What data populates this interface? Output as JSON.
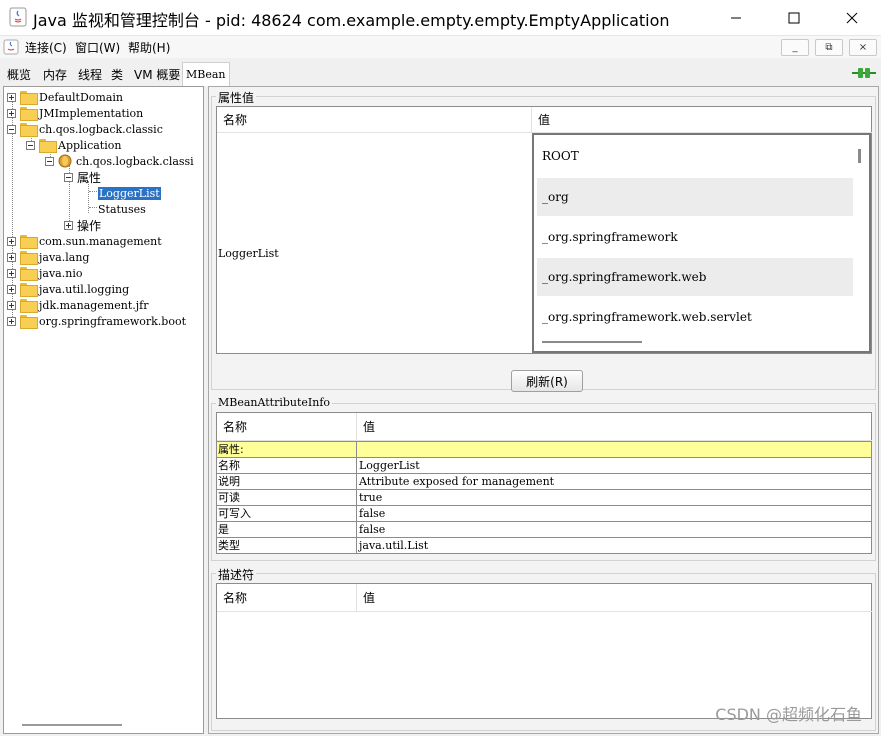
{
  "window": {
    "title": "Java 监视和管理控制台 - pid: 48624 com.example.empty.empty.EmptyApplication",
    "controls": {
      "minimize": "—",
      "maximize": "☐",
      "close": "✕"
    }
  },
  "menu": {
    "items": [
      "连接(C)",
      "窗口(W)",
      "帮助(H)"
    ],
    "mdi_buttons": [
      "_",
      "⧉",
      "×"
    ]
  },
  "tabs": [
    "概览",
    "内存",
    "线程",
    "类",
    "VM 概要",
    "MBean"
  ],
  "active_tab": "MBean",
  "tree": {
    "nodes": [
      "DefaultDomain",
      "JMImplementation",
      "ch.qos.logback.classic",
      "Application",
      "ch.qos.logback.classi",
      "属性",
      "LoggerList",
      "Statuses",
      "操作",
      "com.sun.management",
      "java.lang",
      "java.nio",
      "java.util.logging",
      "jdk.management.jfr",
      "org.springframework.boot"
    ]
  },
  "attr_values": {
    "section_title": "属性值",
    "col_name": "名称",
    "col_value": "值",
    "row_name": "LoggerList",
    "values": [
      "ROOT",
      "_org",
      "_org.springframework",
      "_org.springframework.web",
      "_org.springframework.web.servlet"
    ],
    "refresh_label": "刷新(R)"
  },
  "mbean_info": {
    "section_title": "MBeanAttributeInfo",
    "col_name": "名称",
    "col_value": "值",
    "rows": [
      [
        "属性:",
        ""
      ],
      [
        "名称",
        "LoggerList"
      ],
      [
        "说明",
        "Attribute exposed for management"
      ],
      [
        "可读",
        "true"
      ],
      [
        "可写入",
        "false"
      ],
      [
        "是",
        "false"
      ],
      [
        "类型",
        "java.util.List"
      ]
    ]
  },
  "descriptor": {
    "section_title": "描述符",
    "col_name": "名称",
    "col_value": "值"
  },
  "watermark": "CSDN @超频化石鱼",
  "colors": {
    "highlight_row": "#ffff99",
    "selection": "#2a72c4"
  }
}
